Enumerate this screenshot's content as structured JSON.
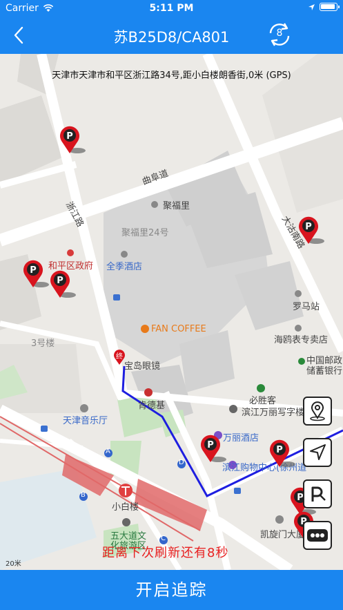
{
  "status_bar": {
    "carrier": "Carrier",
    "time": "5:11 PM"
  },
  "nav": {
    "title": "苏B25D8/CA801",
    "refresh_count": "8",
    "back_icon": "chevron-left-icon",
    "refresh_icon": "refresh-icon"
  },
  "map": {
    "address": "天津市天津市和平区浙江路34号,距小白楼朗香街,0米 (GPS)",
    "countdown": "距离下次刷新还有8秒",
    "scale": "20米",
    "labels": {
      "qufu_road": "曲阜道",
      "zhejiang_road": "浙江路",
      "dagu_road": "大沽南路",
      "jufuli": "聚福里",
      "jufuli24": "聚福里24号",
      "heping_gov": "和平区政府",
      "quanji_hotel": "全季酒店",
      "luoma": "罗马站",
      "haiou": "海鸥表专卖店",
      "fan_coffee": "FAN COFFEE",
      "post": "中国邮政",
      "savings_bank": "储蓄银行",
      "building3": "3号楼",
      "baodao": "宝岛眼镜",
      "kfc": "肯德基",
      "bishengke": "必胜客",
      "binjiang_office": "滨江万丽写字楼",
      "tianjin_music": "天津音乐厅",
      "wanli_hotel": "万丽酒店",
      "binjiang_mall": "滨江购物中心(徐州道",
      "xiaobailou": "小白楼",
      "wudadao": "五大道文",
      "wudadao2": "化旅游区",
      "kaixuanmen": "凯旋门大厦",
      "stop_end": "终",
      "metro_a": "A",
      "metro_b": "B",
      "metro_c": "C",
      "metro_d": "D"
    }
  },
  "side_buttons": [
    "location-pin-icon",
    "navigate-arrow-icon",
    "parking-icon",
    "more-icon"
  ],
  "bottom_button": {
    "label": "开启追踪"
  },
  "colors": {
    "primary": "#1a86f0",
    "route": "#1e1ee0",
    "pin": "#d8141e"
  }
}
